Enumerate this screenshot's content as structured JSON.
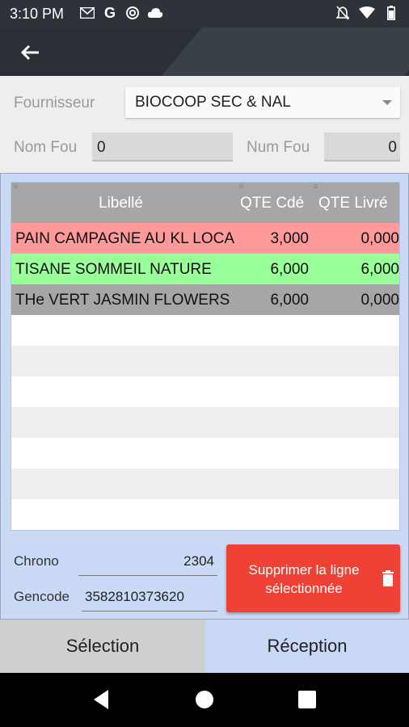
{
  "status_bar": {
    "time": "3:10 PM",
    "icons": [
      "gmail-icon",
      "google-icon",
      "sync-icon",
      "cloud-icon"
    ],
    "right_icons": [
      "notifications-off-icon",
      "wifi-icon",
      "battery-icon"
    ]
  },
  "app_bar": {
    "back_icon": "arrow-left-icon"
  },
  "form": {
    "fournisseur_label": "Fournisseur",
    "fournisseur_value": "BIOCOOP SEC & NAL",
    "nom_fou_label_1": "Nom Fou",
    "nom_fou_value_1": "0",
    "nom_fou_label_2": "Num Fou",
    "nom_fou_value_2": "0"
  },
  "grid": {
    "columns": [
      "Libellé",
      "QTE Cdé",
      "QTE Livré"
    ],
    "rows": [
      {
        "libelle": "PAIN CAMPAGNE AU KL LOCAL",
        "qte_cde": "3,000",
        "qte_livre": "0,000",
        "color": "#ff9a9a"
      },
      {
        "libelle": "TISANE SOMMEIL NATURE",
        "qte_cde": "6,000",
        "qte_livre": "6,000",
        "color": "#99ff99"
      },
      {
        "libelle": "THe VERT JASMIN FLOWERS",
        "qte_cde": "6,000",
        "qte_livre": "0,000",
        "color": "#a6a6a6"
      }
    ],
    "empty_row_colors": [
      "#ffffff",
      "#eeeeee"
    ]
  },
  "footer": {
    "chrono_label": "Chrono",
    "chrono_value": "2304",
    "gencode_label": "Gencode",
    "gencode_value": "3582810373620",
    "delete_button": "Supprimer la ligne sélectionnée",
    "delete_icon": "trash-icon"
  },
  "tabs": {
    "selection": "Sélection",
    "reception": "Réception"
  },
  "colors": {
    "delete": "#ef4136",
    "panel": "#cad9f5",
    "header": "#a6a6a6"
  }
}
